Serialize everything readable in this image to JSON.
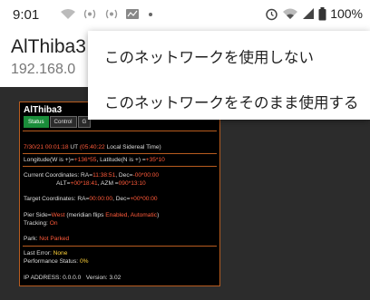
{
  "status_bar": {
    "time": "9:01",
    "battery": "100%",
    "icons": [
      "wifi-icon",
      "broadcast-icon",
      "broadcast-icon",
      "app-icon",
      "dot-icon"
    ],
    "right_icons": [
      "alarm-icon",
      "wifi-signal-icon",
      "cell-signal-icon",
      "battery-icon"
    ]
  },
  "header": {
    "title": "AlThiba3",
    "url": "192.168.0"
  },
  "menu": {
    "items": [
      {
        "label": "このネットワークを使用しない"
      },
      {
        "label": "このネットワークをそのまま使用する"
      }
    ]
  },
  "panel": {
    "title": "AlThiba3",
    "tabs": [
      {
        "label": "Status",
        "active": true
      },
      {
        "label": "Control",
        "active": false
      },
      {
        "label": "G",
        "active": false
      }
    ],
    "date_time": "7/30/21 00:01:18",
    "ut": "UT",
    "lst": "(05:40:22",
    "lst_label": "Local Sidereal Time)",
    "longitude_label": "Longitude(W is +)=",
    "longitude_value": "+136*55",
    "latitude_label": ", Latitude(N is +) =",
    "latitude_value": "+35*10",
    "current_coords_label": "Current Coordinates: RA=",
    "current_ra": "11:38:51",
    "current_dec_label": ", Dec=",
    "current_dec": "-00*00:00",
    "alt_label": "ALT=",
    "alt_value": "+00*18:41",
    "azm_label": ", AZM =",
    "azm_value": "090*13:10",
    "target_label": "Target Coordinates: RA=",
    "target_ra": "00:00:00",
    "target_dec_label": ", Dec=",
    "target_dec": "+00*00:00",
    "pier_label": "Pier Side=",
    "pier_value": "West",
    "flips_label": "(meridian flips",
    "flips_value": "Enabled, Automatic",
    "flips_close": ")",
    "tracking_label": "Tracking:",
    "tracking_value": "On",
    "park_label": "Park:",
    "park_value": "Not Parked",
    "last_error_label": "Last Error:",
    "last_error_value": "None",
    "performance_label": "Performance Status:",
    "performance_value": "0%",
    "ip_label": "IP ADDRESS: 0.0.0.0",
    "version_label": "Version: 3.02"
  }
}
